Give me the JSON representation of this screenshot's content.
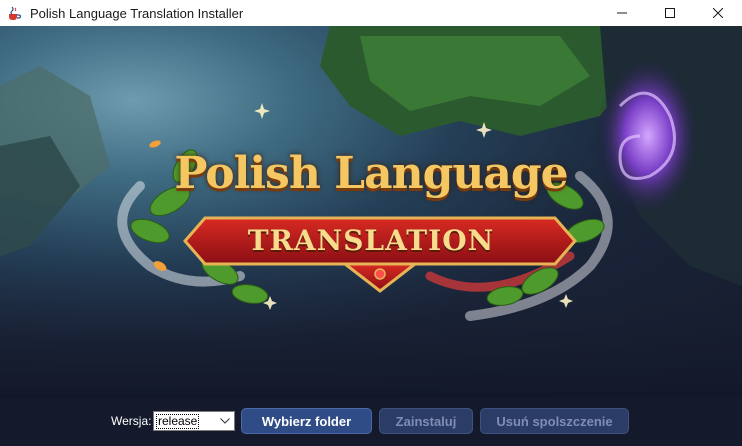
{
  "window": {
    "title": "Polish Language Translation Installer",
    "icon": "java-cup-icon",
    "controls": {
      "minimize": "—",
      "maximize": "☐",
      "close": "✕"
    }
  },
  "banner": {
    "logo_line1": "Polish Language",
    "logo_line2": "TRANSLATION",
    "colors": {
      "gold": "#f4c762",
      "ribbon_red": "#b4171c",
      "leaf_green": "#4f9a2c",
      "portal_purple": "#7a3fc8"
    }
  },
  "controls": {
    "version_label": "Wersja:",
    "version_value": "release",
    "choose_folder": "Wybierz folder",
    "install": "Zainstaluj",
    "remove": "Usuń spolszczenie"
  }
}
